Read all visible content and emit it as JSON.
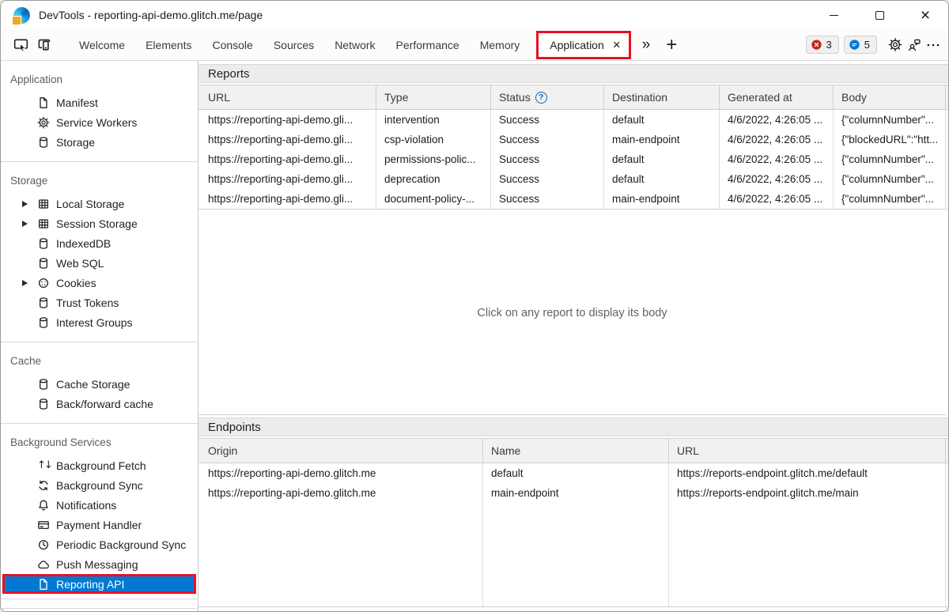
{
  "window": {
    "title": "DevTools - reporting-api-demo.glitch.me/page"
  },
  "glyphs": {
    "tab_close": "×",
    "window_close": "×",
    "overflow_chevron": "»",
    "add_tab": "+",
    "help": "?"
  },
  "toolbar": {
    "tabs": [
      "Welcome",
      "Elements",
      "Console",
      "Sources",
      "Network",
      "Performance",
      "Memory"
    ],
    "active_tab": {
      "label": "Application"
    },
    "badges": {
      "errors": "3",
      "messages": "5"
    }
  },
  "colors": {
    "accent_blue": "#0078d4",
    "annotation_red": "#e81123",
    "error_badge": "#c42b1c",
    "message_badge": "#0078d4"
  },
  "sidebar": {
    "sections": [
      {
        "title": "Application",
        "items": [
          {
            "label": "Manifest",
            "icon": "file-icon"
          },
          {
            "label": "Service Workers",
            "icon": "gear-icon"
          },
          {
            "label": "Storage",
            "icon": "database-icon"
          }
        ]
      },
      {
        "title": "Storage",
        "items": [
          {
            "label": "Local Storage",
            "icon": "table-icon",
            "expandable": true
          },
          {
            "label": "Session Storage",
            "icon": "table-icon",
            "expandable": true
          },
          {
            "label": "IndexedDB",
            "icon": "database-icon"
          },
          {
            "label": "Web SQL",
            "icon": "database-icon"
          },
          {
            "label": "Cookies",
            "icon": "cookie-icon",
            "expandable": true
          },
          {
            "label": "Trust Tokens",
            "icon": "database-icon"
          },
          {
            "label": "Interest Groups",
            "icon": "database-icon"
          }
        ]
      },
      {
        "title": "Cache",
        "items": [
          {
            "label": "Cache Storage",
            "icon": "database-icon"
          },
          {
            "label": "Back/forward cache",
            "icon": "database-icon"
          }
        ]
      },
      {
        "title": "Background Services",
        "items": [
          {
            "label": "Background Fetch",
            "icon": "up-down-arrows-icon"
          },
          {
            "label": "Background Sync",
            "icon": "sync-icon"
          },
          {
            "label": "Notifications",
            "icon": "bell-icon"
          },
          {
            "label": "Payment Handler",
            "icon": "card-icon"
          },
          {
            "label": "Periodic Background Sync",
            "icon": "clock-icon"
          },
          {
            "label": "Push Messaging",
            "icon": "cloud-icon"
          },
          {
            "label": "Reporting API",
            "icon": "file-icon",
            "selected": true
          }
        ]
      }
    ]
  },
  "reports": {
    "title": "Reports",
    "columns": [
      "URL",
      "Type",
      "Status",
      "Destination",
      "Generated at",
      "Body"
    ],
    "rows": [
      [
        "https://reporting-api-demo.gli...",
        "intervention",
        "Success",
        "default",
        "4/6/2022, 4:26:05 ...",
        "{\"columnNumber\"..."
      ],
      [
        "https://reporting-api-demo.gli...",
        "csp-violation",
        "Success",
        "main-endpoint",
        "4/6/2022, 4:26:05 ...",
        "{\"blockedURL\":\"htt..."
      ],
      [
        "https://reporting-api-demo.gli...",
        "permissions-polic...",
        "Success",
        "default",
        "4/6/2022, 4:26:05 ...",
        "{\"columnNumber\"..."
      ],
      [
        "https://reporting-api-demo.gli...",
        "deprecation",
        "Success",
        "default",
        "4/6/2022, 4:26:05 ...",
        "{\"columnNumber\"..."
      ],
      [
        "https://reporting-api-demo.gli...",
        "document-policy-...",
        "Success",
        "main-endpoint",
        "4/6/2022, 4:26:05 ...",
        "{\"columnNumber\"..."
      ]
    ],
    "empty_message": "Click on any report to display its body"
  },
  "endpoints": {
    "title": "Endpoints",
    "columns": [
      "Origin",
      "Name",
      "URL"
    ],
    "rows": [
      [
        "https://reporting-api-demo.glitch.me",
        "default",
        "https://reports-endpoint.glitch.me/default"
      ],
      [
        "https://reporting-api-demo.glitch.me",
        "main-endpoint",
        "https://reports-endpoint.glitch.me/main"
      ]
    ]
  }
}
